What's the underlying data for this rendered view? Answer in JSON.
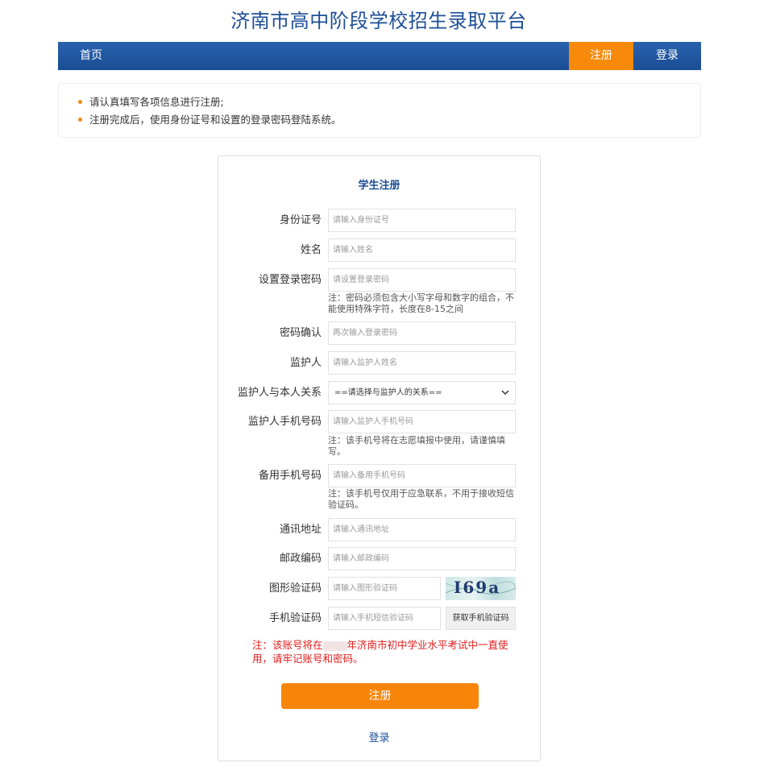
{
  "site": {
    "title": "济南市高中阶段学校招生录取平台"
  },
  "nav": {
    "home": "首页",
    "register": "注册",
    "login": "登录"
  },
  "notice": [
    "请认真填写各项信息进行注册;",
    "注册完成后，使用身份证号和设置的登录密码登陆系统。"
  ],
  "form": {
    "title": "学生注册",
    "fields": {
      "id_number": {
        "label": "身份证号",
        "placeholder": "请输入身份证号"
      },
      "name": {
        "label": "姓名",
        "placeholder": "请输入姓名"
      },
      "password": {
        "label": "设置登录密码",
        "placeholder": "请设置登录密码",
        "hint": "注：密码必须包含大小写字母和数字的组合，不能使用特殊字符，长度在8-15之间"
      },
      "confirm": {
        "label": "密码确认",
        "placeholder": "再次输入登录密码"
      },
      "guardian": {
        "label": "监护人",
        "placeholder": "请输入监护人姓名"
      },
      "relation": {
        "label": "监护人与本人关系",
        "value": "==请选择与监护人的关系=="
      },
      "guardian_phone": {
        "label": "监护人手机号码",
        "placeholder": "请输入监护人手机号码",
        "hint": "注：该手机号将在志愿填报中使用，请谨慎填写。"
      },
      "backup_phone": {
        "label": "备用手机号码",
        "placeholder": "请输入备用手机号码",
        "hint": "注：该手机号仅用于应急联系，不用于接收短信验证码。"
      },
      "address": {
        "label": "通讯地址",
        "placeholder": "请输入通讯地址"
      },
      "postcode": {
        "label": "邮政编码",
        "placeholder": "请输入邮政编码"
      },
      "captcha": {
        "label": "图形验证码",
        "placeholder": "请输入图形验证码",
        "image_text": "I69a"
      },
      "sms": {
        "label": "手机验证码",
        "placeholder": "请输入手机短信验证码",
        "button": "获取手机验证码"
      }
    },
    "warning": {
      "prefix": "注：该账号将在",
      "suffix": "年济南市初中学业水平考试中一直使用，请牢记账号和密码。"
    },
    "submit": "注册",
    "login_link": "登录"
  },
  "colors": {
    "primary": "#1e4f97",
    "accent": "#f7890b",
    "warning": "#e01b1b"
  }
}
